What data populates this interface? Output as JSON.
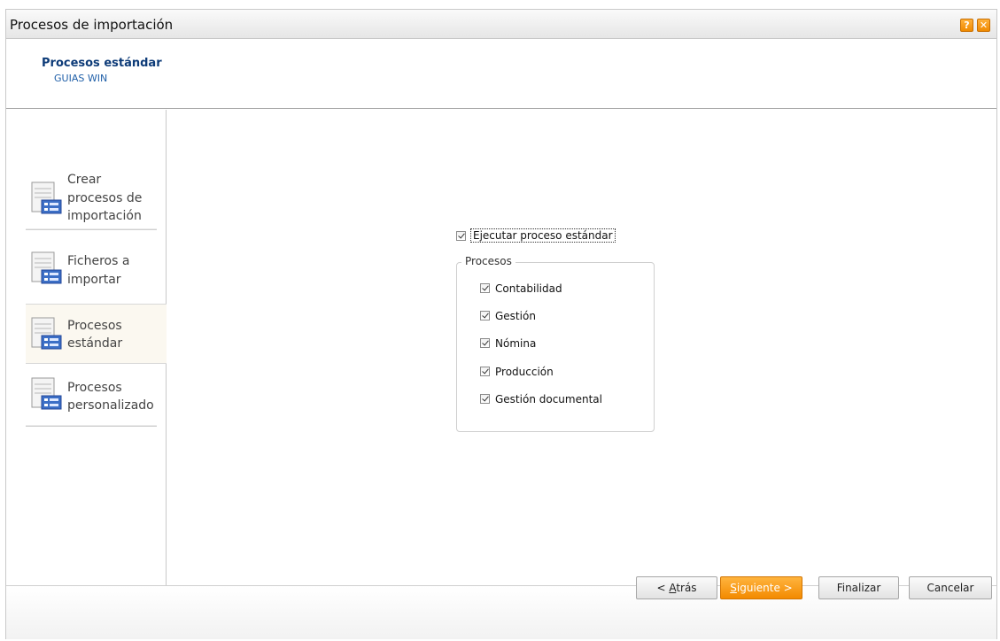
{
  "window": {
    "title": "Procesos de importación",
    "help_label": "?",
    "close_label": "✕"
  },
  "header": {
    "title": "Procesos estándar",
    "subtitle": "GUIAS WIN"
  },
  "sidebar": {
    "items": [
      {
        "label_lines": [
          "Crear",
          "procesos de",
          "importación"
        ],
        "active": false
      },
      {
        "label_lines": [
          "Ficheros a",
          "importar"
        ],
        "active": false
      },
      {
        "label_lines": [
          "Procesos",
          "estándar"
        ],
        "active": true
      },
      {
        "label_lines": [
          "Procesos",
          "personalizado"
        ],
        "active": false
      }
    ]
  },
  "content": {
    "execute_label": "Ejecutar proceso estándar",
    "execute_checked": true,
    "group_title": "Procesos",
    "processes": [
      {
        "label": "Contabilidad",
        "checked": true
      },
      {
        "label": "Gestión",
        "checked": true
      },
      {
        "label": "Nómina",
        "checked": true
      },
      {
        "label": "Producción",
        "checked": true
      },
      {
        "label": "Gestión documental",
        "checked": true
      }
    ]
  },
  "footer": {
    "back_label_prefix": "< ",
    "back_label_mnemonic": "A",
    "back_label_rest": "trás",
    "next_label_mnemonic": "S",
    "next_label_rest": "iguiente >",
    "finish_label": "Finalizar",
    "cancel_label": "Cancelar"
  },
  "colors": {
    "accent_orange": "#f38a00",
    "header_title_blue": "#0d3b78",
    "header_sub_blue": "#1f5fa8"
  }
}
